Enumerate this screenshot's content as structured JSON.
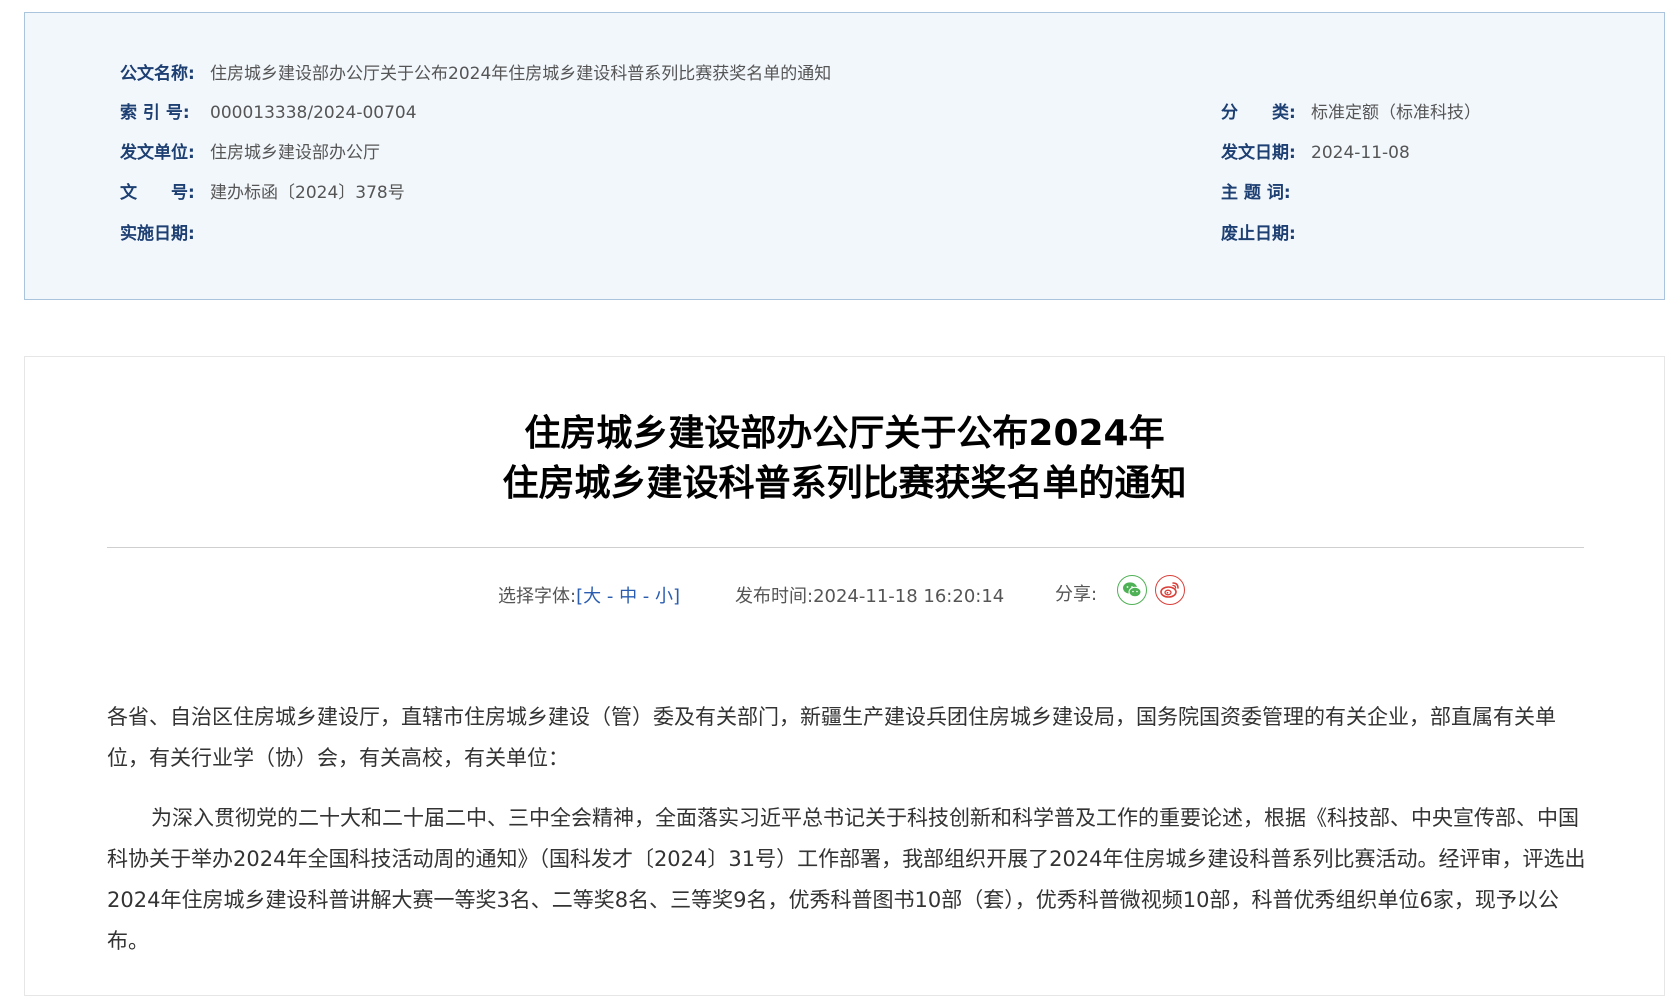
{
  "meta": {
    "doc_name_label": "公文名称:",
    "doc_name_value": "住房城乡建设部办公厅关于公布2024年住房城乡建设科普系列比赛获奖名单的通知",
    "index_label": "索 引 号:",
    "index_value": "000013338/2024-00704",
    "category_label": "分　　类:",
    "category_value": "标准定额（标准科技）",
    "issuer_label": "发文单位:",
    "issuer_value": "住房城乡建设部办公厅",
    "issue_date_label": "发文日期:",
    "issue_date_value": "2024-11-08",
    "doc_no_label": "文　　号:",
    "doc_no_value": "建办标函〔2024〕378号",
    "keywords_label": "主 题 词:",
    "keywords_value": "",
    "effective_label": "实施日期:",
    "effective_value": "",
    "expire_label": "废止日期:",
    "expire_value": ""
  },
  "article": {
    "title_line1": "住房城乡建设部办公厅关于公布2024年",
    "title_line2": "住房城乡建设科普系列比赛获奖名单的通知",
    "font_select_label": "选择字体:",
    "bracket_open": "[",
    "bracket_close": "]",
    "size_large": "大",
    "size_medium": "中",
    "size_small": "小",
    "separator": " - ",
    "publish_label": "发布时间:",
    "publish_time": "2024-11-18 16:20:14",
    "share_label": "分享:",
    "paragraph1": "各省、自治区住房城乡建设厅，直辖市住房城乡建设（管）委及有关部门，新疆生产建设兵团住房城乡建设局，国务院国资委管理的有关企业，部直属有关单位，有关行业学（协）会，有关高校，有关单位：",
    "paragraph2": "为深入贯彻党的二十大和二十届二中、三中全会精神，全面落实习近平总书记关于科技创新和科学普及工作的重要论述，根据《科技部、中央宣传部、中国科协关于举办2024年全国科技活动周的通知》（国科发才〔2024〕31号）工作部署，我部组织开展了2024年住房城乡建设科普系列比赛活动。经评审，评选出2024年住房城乡建设科普讲解大赛一等奖3名、二等奖8名、三等奖9名，优秀科普图书10部（套），优秀科普微视频10部，科普优秀组织单位6家，现予以公布。"
  },
  "icons": {
    "wechat": "wechat-icon",
    "weibo": "weibo-icon"
  },
  "colors": {
    "label": "#1d3f72",
    "link": "#2a5db0",
    "wechat": "#4fb155",
    "weibo": "#d9403a",
    "panel_bg": "#f2f7fc"
  }
}
